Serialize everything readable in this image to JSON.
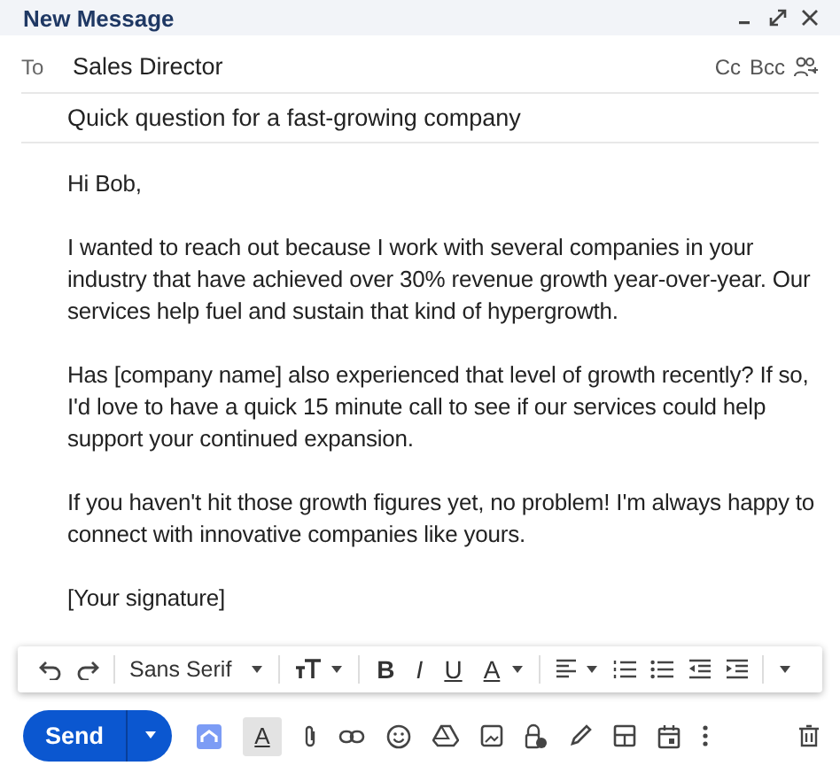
{
  "window": {
    "title": "New Message"
  },
  "to": {
    "label": "To",
    "value": "Sales Director",
    "cc": "Cc",
    "bcc": "Bcc"
  },
  "subject": {
    "value": "Quick question for a fast-growing company"
  },
  "body": [
    "Hi Bob,",
    "I wanted to reach out because I work with several companies in your industry that have achieved over 30% revenue growth year-over-year. Our services help fuel and sustain that kind of hypergrowth.",
    "Has [company name] also experienced that level of growth recently? If so, I'd love to have a quick 15 minute call to see if our services could help support your continued expansion.",
    "If you haven't hit those growth figures yet, no problem! I'm always happy to connect with innovative companies like yours.",
    "[Your signature]"
  ],
  "format_bar": {
    "font": "Sans Serif",
    "bold": "B",
    "italic": "I",
    "underline": "U",
    "text_color": "A"
  },
  "bottom_bar": {
    "send": "Send",
    "formatting": {
      "label": "A",
      "selected": true
    }
  }
}
